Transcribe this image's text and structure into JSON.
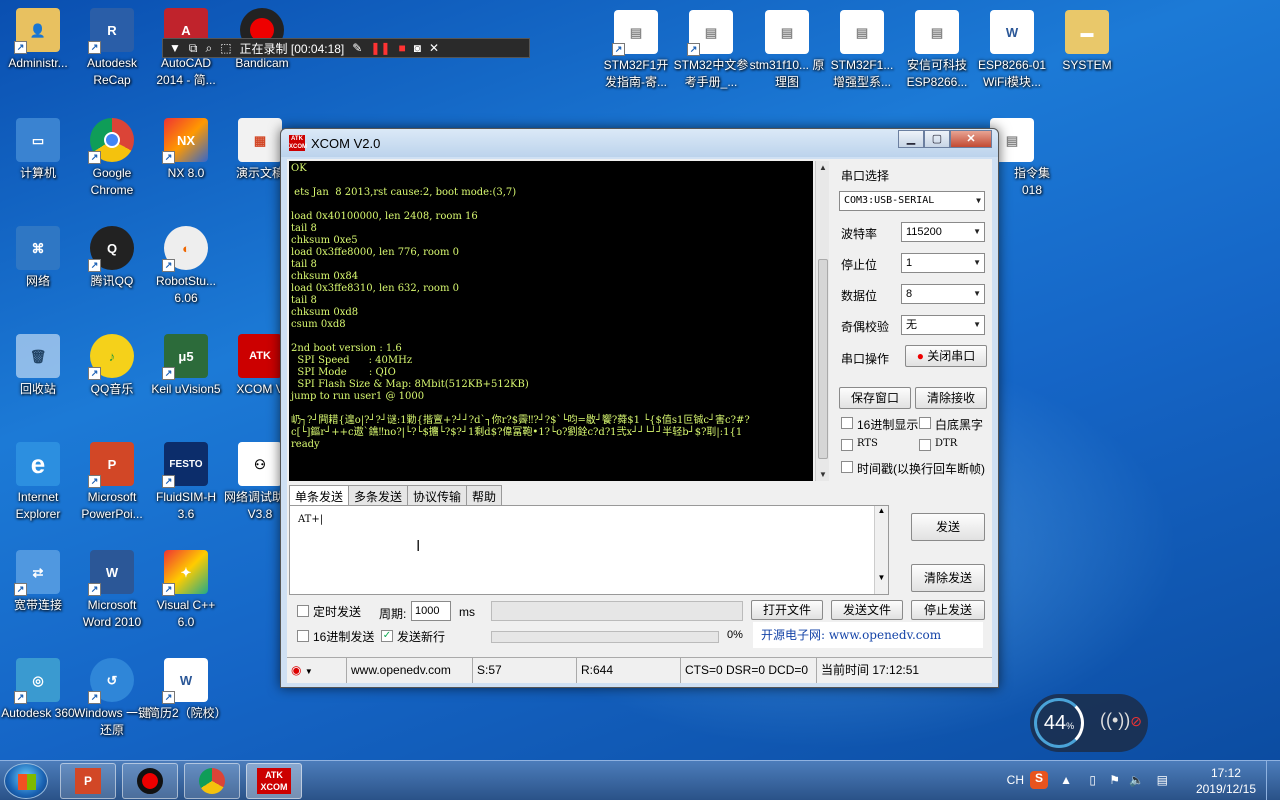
{
  "desktop": {
    "icons_col1": [
      {
        "label": "Administr...",
        "icon": "user-folder-icon"
      },
      {
        "label": "计算机",
        "icon": "computer-icon"
      },
      {
        "label": "网络",
        "icon": "network-icon"
      },
      {
        "label": "回收站",
        "icon": "recycle-bin-icon"
      },
      {
        "label": "Internet Explorer",
        "icon": "ie-icon"
      },
      {
        "label": "宽带连接",
        "icon": "broadband-icon"
      },
      {
        "label": "Autodesk 360",
        "icon": "autodesk360-icon"
      }
    ],
    "icons_col2": [
      {
        "label": "Autodesk ReCap",
        "icon": "recap-icon"
      },
      {
        "label": "Google Chrome",
        "icon": "chrome-icon"
      },
      {
        "label": "腾讯QQ",
        "icon": "qq-icon"
      },
      {
        "label": "QQ音乐",
        "icon": "qqmusic-icon"
      },
      {
        "label": "Microsoft PowerPoi...",
        "icon": "powerpoint-icon"
      },
      {
        "label": "Microsoft Word 2010",
        "icon": "word-icon"
      },
      {
        "label": "Windows 一键还原",
        "icon": "restore-icon"
      }
    ],
    "icons_col3": [
      {
        "label": "AutoCAD 2014 - 简...",
        "icon": "autocad-icon"
      },
      {
        "label": "NX 8.0",
        "icon": "nx-icon"
      },
      {
        "label": "RobotStu... 6.06",
        "icon": "robotstudio-icon"
      },
      {
        "label": "Keil uVision5",
        "icon": "keil-icon"
      },
      {
        "label": "FluidSIM-H 3.6",
        "icon": "fluidsim-icon"
      },
      {
        "label": "Visual C++ 6.0",
        "icon": "vc-icon"
      },
      {
        "label": "简历2（院校）",
        "icon": "word-doc-icon"
      }
    ],
    "icons_col4": [
      {
        "label": "Bandicam",
        "icon": "bandicam-icon"
      },
      {
        "label": "演示文稿",
        "icon": "ppt-doc-icon"
      },
      {
        "label": "XCOM V",
        "icon": "xcom-icon"
      },
      {
        "label": "网络调试助手V3.8",
        "icon": "netdebug-icon"
      }
    ],
    "icons_top_right": [
      {
        "label": "STM32F1开发指南-寄...",
        "icon": "doc-icon"
      },
      {
        "label": "STM32中文参考手册_...",
        "icon": "doc-icon"
      },
      {
        "label": "stm31f10... 原理图",
        "icon": "doc-icon"
      },
      {
        "label": "STM32F1... 增强型系...",
        "icon": "doc-icon"
      },
      {
        "label": "安信可科技ESP8266...",
        "icon": "doc-icon"
      },
      {
        "label": "ESP8266-01 WiFi模块...",
        "icon": "word-doc-icon"
      },
      {
        "label": "SYSTEM",
        "icon": "folder-icon"
      }
    ],
    "partial_icon": {
      "line1": "指令集",
      "line2": "018"
    }
  },
  "bandicam": {
    "status": "正在录制 [00:04:18]"
  },
  "xcom": {
    "title": "XCOM V2.0",
    "terminal_lines": [
      "OK",
      "",
      " ets Jan  8 2013,rst cause:2, boot mode:(3,7)",
      "",
      "load 0x40100000, len 2408, room 16",
      "tail 8",
      "chksum 0xe5",
      "load 0x3ffe8000, len 776, room 0",
      "tail 8",
      "chksum 0x84",
      "load 0x3ffe8310, len 632, room 0",
      "tail 8",
      "chksum 0xd8",
      "csum 0xd8",
      "",
      "2nd boot version : 1.6",
      "  SPI Speed      : 40MHz",
      "  SPI Mode       : QIO",
      "  SPI Flash Size & Map: 8Mbit(512KB+512KB)",
      "jump to run user1 @ 1000",
      "",
      "屷┐?┘闁耤{遑o|?┘?┘谜:1勦{揩亶+?┘┘?d`┐你r?$霽‼?┘?$`└呁=敭┘饗?蕣$1 └{$值s1叵铖c┘害c?#?",
      "c[└]鏂r┘++c遨`鐎‼no?|└?└$攟└?$?┘1剩d$?偉冨鞄•1?└o?劉銓c?d?1弐x┘┘└┘┘半轻b┘$?刵|:1{1",
      "ready"
    ],
    "right_panel": {
      "port_select_label": "串口选择",
      "port_value": "COM3:USB-SERIAL",
      "baud_label": "波特率",
      "baud_value": "115200",
      "stopbit_label": "停止位",
      "stopbit_value": "1",
      "databit_label": "数据位",
      "databit_value": "8",
      "parity_label": "奇偶校验",
      "parity_value": "无",
      "port_op_label": "串口操作",
      "close_port_btn": "关闭串口",
      "save_window_btn": "保存窗口",
      "clear_receive_btn": "清除接收",
      "hex_display_label": "16进制显示",
      "white_black_label": "白底黑字",
      "rts_label": "RTS",
      "dtr_label": "DTR",
      "timestamp_label": "时间戳(以换行回车断帧)"
    },
    "tabs": [
      "单条发送",
      "多条发送",
      "协议传输",
      "帮助"
    ],
    "send_text": "AT+|",
    "send_btn": "发送",
    "clear_send_btn": "清除发送",
    "timed_send_label": "定时发送",
    "period_label": "周期:",
    "period_value": "1000",
    "period_unit": "ms",
    "open_file_btn": "打开文件",
    "send_file_btn": "发送文件",
    "stop_send_btn": "停止发送",
    "hex_send_label": "16进制发送",
    "newline_label": "发送新行",
    "progress_pct": "0%",
    "banner": "开源电子网: www.openedv.com",
    "status": {
      "url": "www.openedv.com",
      "sent": "S:57",
      "received": "R:644",
      "lines": "CTS=0 DSR=0 DCD=0",
      "time": "当前时间 17:12:51"
    }
  },
  "network_widget": {
    "percent": "44",
    "unit": "%"
  },
  "taskbar": {
    "tray_lang": "CH",
    "time": "17:12",
    "date": "2019/12/15"
  }
}
